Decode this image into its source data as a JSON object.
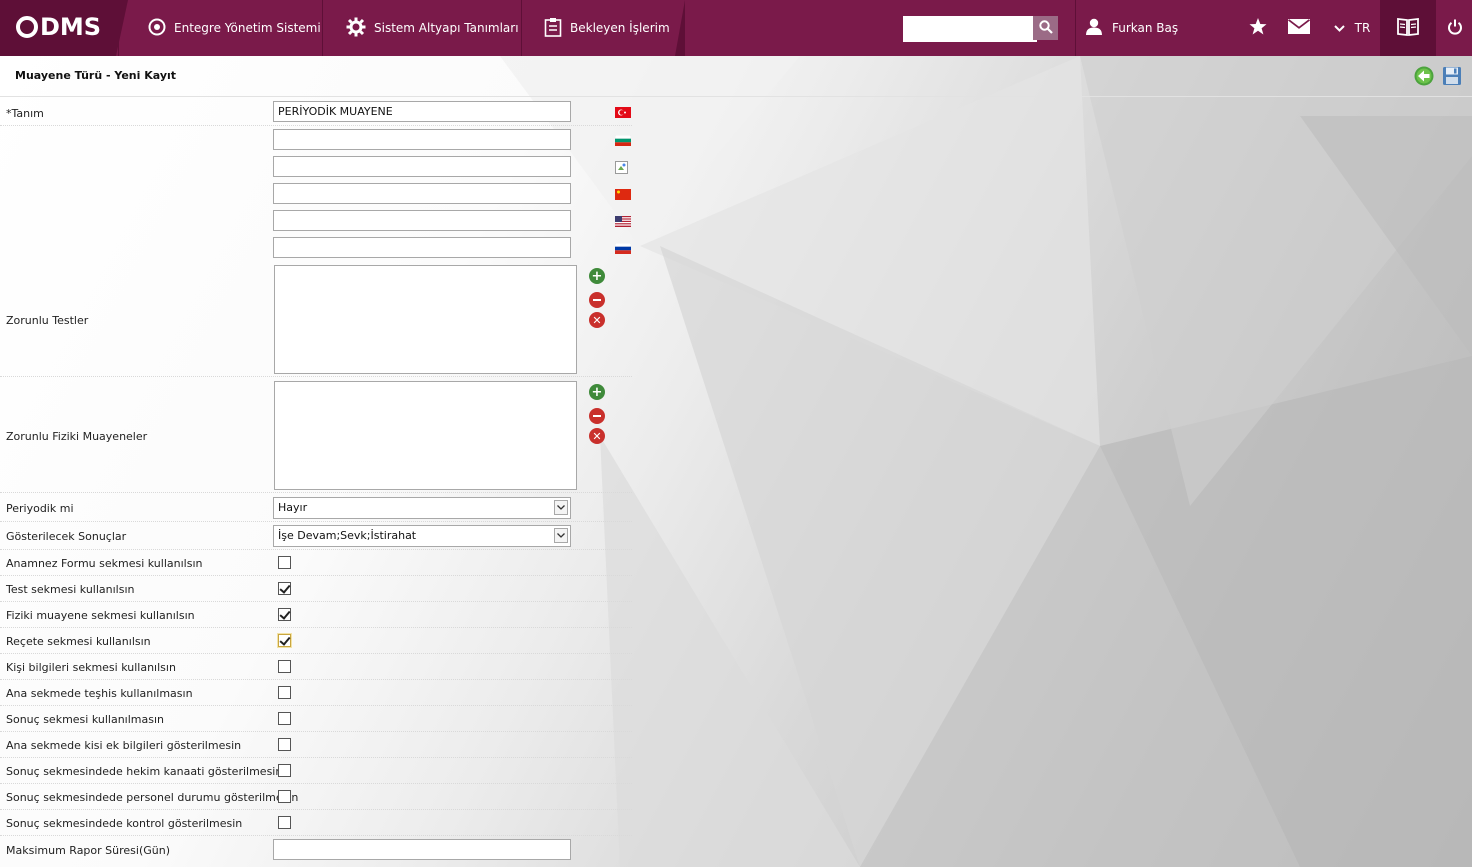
{
  "header": {
    "logo_text": "DMS",
    "nav": [
      {
        "label": "Entegre Yönetim Sistemi",
        "icon": "integrated-system-icon"
      },
      {
        "label": "Sistem Altyapı Tanımları",
        "icon": "gear-icon"
      },
      {
        "label": "Bekleyen İşlerim",
        "icon": "clipboard-icon"
      }
    ],
    "search": {
      "value": "",
      "placeholder": ""
    },
    "user_name": "Furkan Baş",
    "language": "TR"
  },
  "page": {
    "title": "Muayene Türü - Yeni Kayıt"
  },
  "form": {
    "tanim_label": "*Tanım",
    "tanim_values": [
      "PERİYODİK MUAYENE",
      "",
      "",
      "",
      "",
      ""
    ],
    "flags": [
      "flag-tr-icon",
      "flag-bg-icon",
      "flag-broken-icon",
      "flag-cn-icon",
      "flag-us-icon",
      "flag-ru-icon"
    ],
    "zorunlu_testler_label": "Zorunlu Testler",
    "zorunlu_fiziki_label": "Zorunlu Fiziki Muayeneler",
    "periyodik_label": "Periyodik mi",
    "periyodik_value": "Hayır",
    "sonuclar_label": "Gösterilecek Sonuçlar",
    "sonuclar_value": "İşe Devam;Sevk;İstirahat",
    "checkboxes": [
      {
        "label": "Anamnez Formu sekmesi kullanılsın",
        "checked": false
      },
      {
        "label": "Test sekmesi kullanılsın",
        "checked": true
      },
      {
        "label": "Fiziki muayene sekmesi kullanılsın",
        "checked": true
      },
      {
        "label": "Reçete sekmesi kullanılsın",
        "checked": true
      },
      {
        "label": "Kişi bilgileri sekmesi kullanılsın",
        "checked": false
      },
      {
        "label": "Ana sekmede teşhis kullanılmasın",
        "checked": false
      },
      {
        "label": "Sonuç sekmesi kullanılmasın",
        "checked": false
      },
      {
        "label": "Ana sekmede kisi ek bilgileri gösterilmesin",
        "checked": false
      },
      {
        "label": "Sonuç sekmesindede hekim kanaati gösterilmesin",
        "checked": false
      },
      {
        "label": "Sonuç sekmesindede personel durumu gösterilmesin",
        "checked": false
      },
      {
        "label": "Sonuç sekmesindede kontrol gösterilmesin",
        "checked": false
      }
    ],
    "max_rapor_label": "Maksimum Rapor Süresi(Gün)",
    "max_rapor_value": ""
  },
  "colors": {
    "header_bg": "#7a1a4a",
    "header_dark": "#5e0f37",
    "add_green": "#3f8a3a",
    "remove_red": "#c9302c"
  }
}
